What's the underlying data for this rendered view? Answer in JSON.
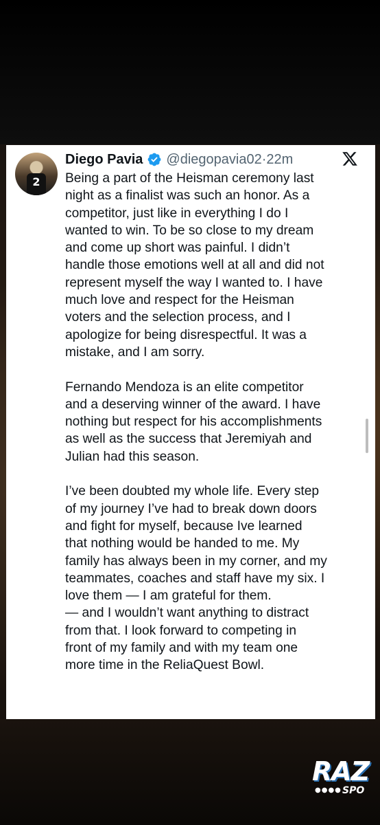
{
  "tweet": {
    "display_name": "Diego Pavia",
    "handle": "@diegopavia02",
    "separator": " · ",
    "time": "22m",
    "verified": true,
    "avatar_jersey_number": "2",
    "lines": [
      "Being a part of the Heisman ceremony last",
      "night as a finalist was such an honor. As a",
      "competitor, just like in everything I do I",
      "wanted to win. To be so close to my dream",
      "and come up short was painful. I didn’t",
      "handle those emotions well at all and did not",
      "represent myself the way I wanted to. I have",
      "much love and respect for the Heisman",
      "voters and the selection process, and I",
      "apologize for being disrespectful. It was a",
      "mistake, and I am sorry.",
      "",
      "Fernando Mendoza is an elite competitor",
      "and a deserving winner of the award. I have",
      "nothing but respect for his accomplishments",
      "as well as the success that Jeremiyah and",
      "Julian had this season.",
      "",
      "I’ve been doubted my whole life. Every step",
      "of my journey I’ve had to break down doors",
      "and fight for myself, because Ive learned",
      "that nothing would be handed to me. My",
      "family has always been in my corner, and my",
      "teammates, coaches and staff have my six. I",
      "love them — I am grateful for them.",
      "— and I wouldn’t want anything to distract",
      "from that. I look forward to competing in",
      "front of my family and with my team one",
      "more time in the ReliaQuest Bowl."
    ]
  },
  "icons": {
    "verified": "verified-badge-icon",
    "x": "x-logo-icon"
  },
  "colors": {
    "verified_blue": "#1d9bf0",
    "text_primary": "#0f1419",
    "text_secondary": "#536471"
  },
  "watermark": {
    "main": "RAZ",
    "sub": "SPO"
  }
}
